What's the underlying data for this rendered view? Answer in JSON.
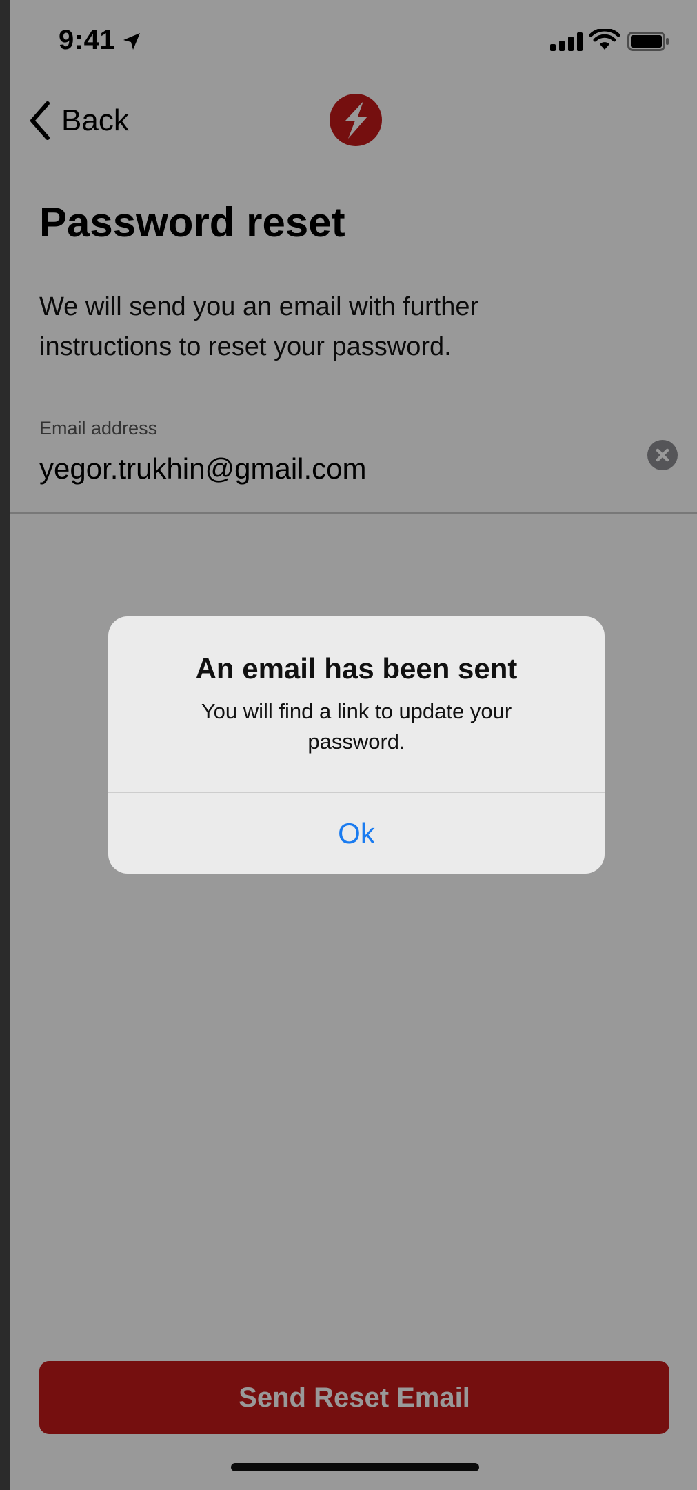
{
  "status_bar": {
    "time": "9:41",
    "icons": [
      "location-arrow-icon",
      "cellular-signal-icon",
      "wifi-icon",
      "battery-icon"
    ]
  },
  "nav": {
    "back_label": "Back",
    "logo_icon": "lightning-bolt-logo-icon"
  },
  "page": {
    "title": "Password reset",
    "description": "We will send you an email with further instructions to reset your password."
  },
  "form": {
    "email_label": "Email address",
    "email_value": "yegor.trukhin@gmail.com",
    "clear_icon": "clear-circle-icon"
  },
  "primary_button": {
    "label": "Send Reset Email"
  },
  "alert": {
    "title": "An email has been sent",
    "message": "You will find a link to update your password.",
    "ok_label": "Ok"
  },
  "colors": {
    "brand_red": "#c41a1a",
    "ios_blue": "#1a7bf0",
    "alert_background": "#ebebeb"
  }
}
